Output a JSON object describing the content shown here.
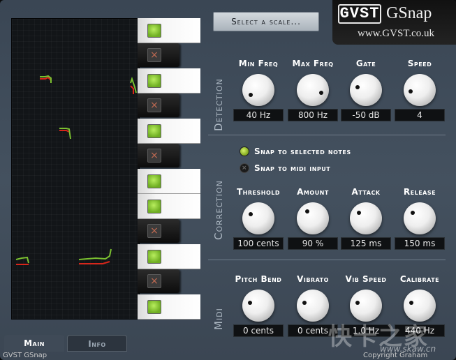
{
  "app": {
    "logo_mark": "GVST",
    "logo_name": "GSnap",
    "logo_url": "www.GVST.co.uk"
  },
  "scale_button": {
    "label": "Select a scale..."
  },
  "keyboard": {
    "keys": [
      {
        "type": "white",
        "state": "on"
      },
      {
        "type": "black",
        "state": "off",
        "symbol": "×"
      },
      {
        "type": "white",
        "state": "on"
      },
      {
        "type": "black",
        "state": "off",
        "symbol": "×"
      },
      {
        "type": "white",
        "state": "on"
      },
      {
        "type": "black",
        "state": "off",
        "symbol": "×"
      },
      {
        "type": "white",
        "state": "on"
      },
      {
        "type": "white",
        "state": "on"
      },
      {
        "type": "black",
        "state": "off",
        "symbol": "×"
      },
      {
        "type": "white",
        "state": "on"
      },
      {
        "type": "black",
        "state": "off",
        "symbol": "×"
      },
      {
        "type": "white",
        "state": "on"
      }
    ]
  },
  "detection": {
    "label": "Detection",
    "knobs": [
      {
        "title": "Min Freq",
        "value": "40 Hz"
      },
      {
        "title": "Max Freq",
        "value": "800 Hz"
      },
      {
        "title": "Gate",
        "value": "-50 dB"
      },
      {
        "title": "Speed",
        "value": "4"
      }
    ]
  },
  "correction": {
    "label": "Correction",
    "radio_selected": "Snap to selected notes",
    "radio_midi": "Snap to midi input",
    "knobs": [
      {
        "title": "Threshold",
        "value": "100 cents"
      },
      {
        "title": "Amount",
        "value": "90 %"
      },
      {
        "title": "Attack",
        "value": "125 ms"
      },
      {
        "title": "Release",
        "value": "150 ms"
      }
    ]
  },
  "midi": {
    "label": "Midi",
    "knobs": [
      {
        "title": "Pitch Bend",
        "value": "0 cents"
      },
      {
        "title": "Vibrato",
        "value": "0 cents"
      },
      {
        "title": "Vib Speed",
        "value": "1.0 Hz"
      },
      {
        "title": "Calibrate",
        "value": "440 Hz"
      }
    ]
  },
  "tabs": {
    "main": "Main",
    "info": "Info"
  },
  "footer": {
    "left": "GVST GSnap",
    "right": "Copyright Graham"
  },
  "watermark": {
    "text": "快卡之家",
    "url": "www.skaw.cn"
  },
  "colors": {
    "accent_green": "#7ac030",
    "pitch_red": "#d8261a",
    "panel": "#3f4b58"
  }
}
